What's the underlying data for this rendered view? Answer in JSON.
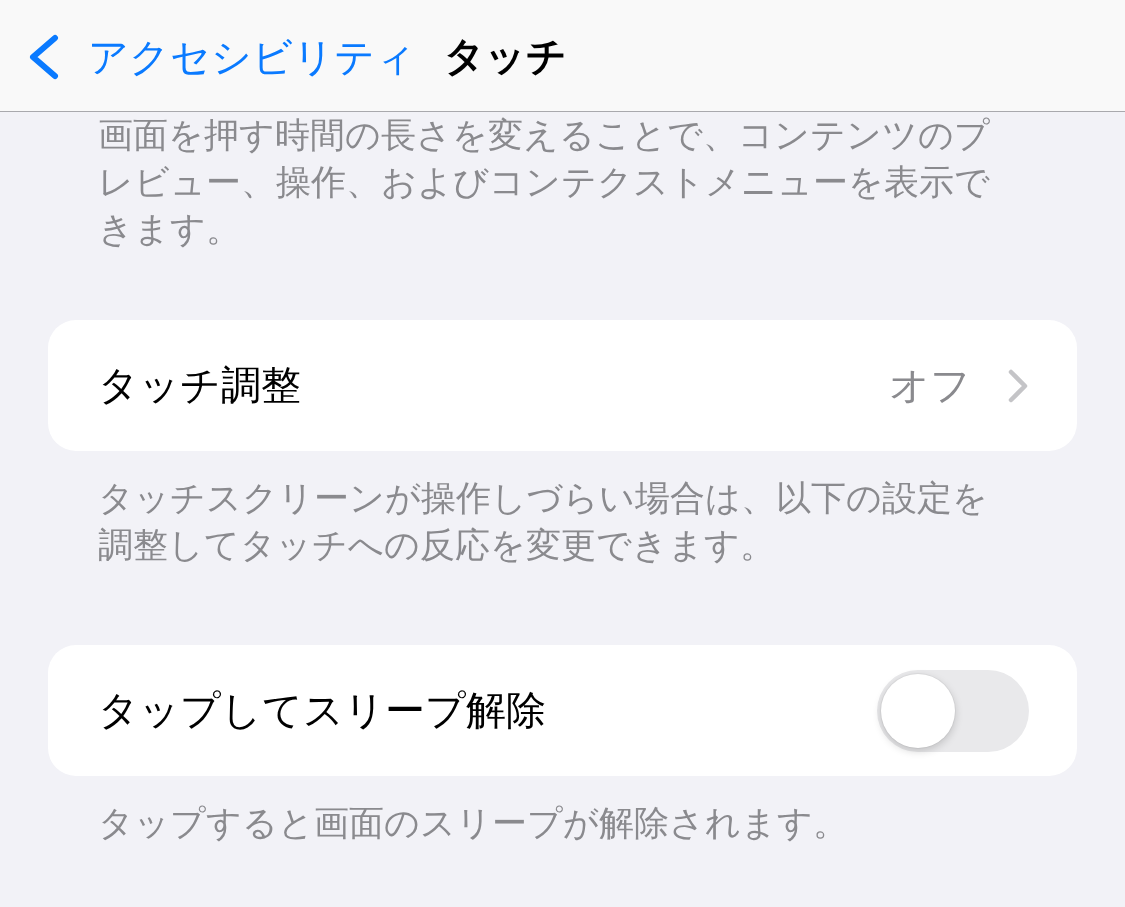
{
  "nav": {
    "back_label": "アクセシビリティ",
    "title": "タッチ"
  },
  "intro_text": "画面を押す時間の長さを変えることで、コンテンツのプレビュー、操作、およびコンテクストメニューを表示できます。",
  "groups": [
    {
      "rows": [
        {
          "kind": "link",
          "label": "タッチ調整",
          "value": "オフ"
        }
      ],
      "footer": "タッチスクリーンが操作しづらい場合は、以下の設定を調整してタッチへの反応を変更できます。"
    },
    {
      "rows": [
        {
          "kind": "toggle",
          "label": "タップしてスリープ解除",
          "on": false
        }
      ],
      "footer": "タップすると画面のスリープが解除されます。"
    }
  ]
}
